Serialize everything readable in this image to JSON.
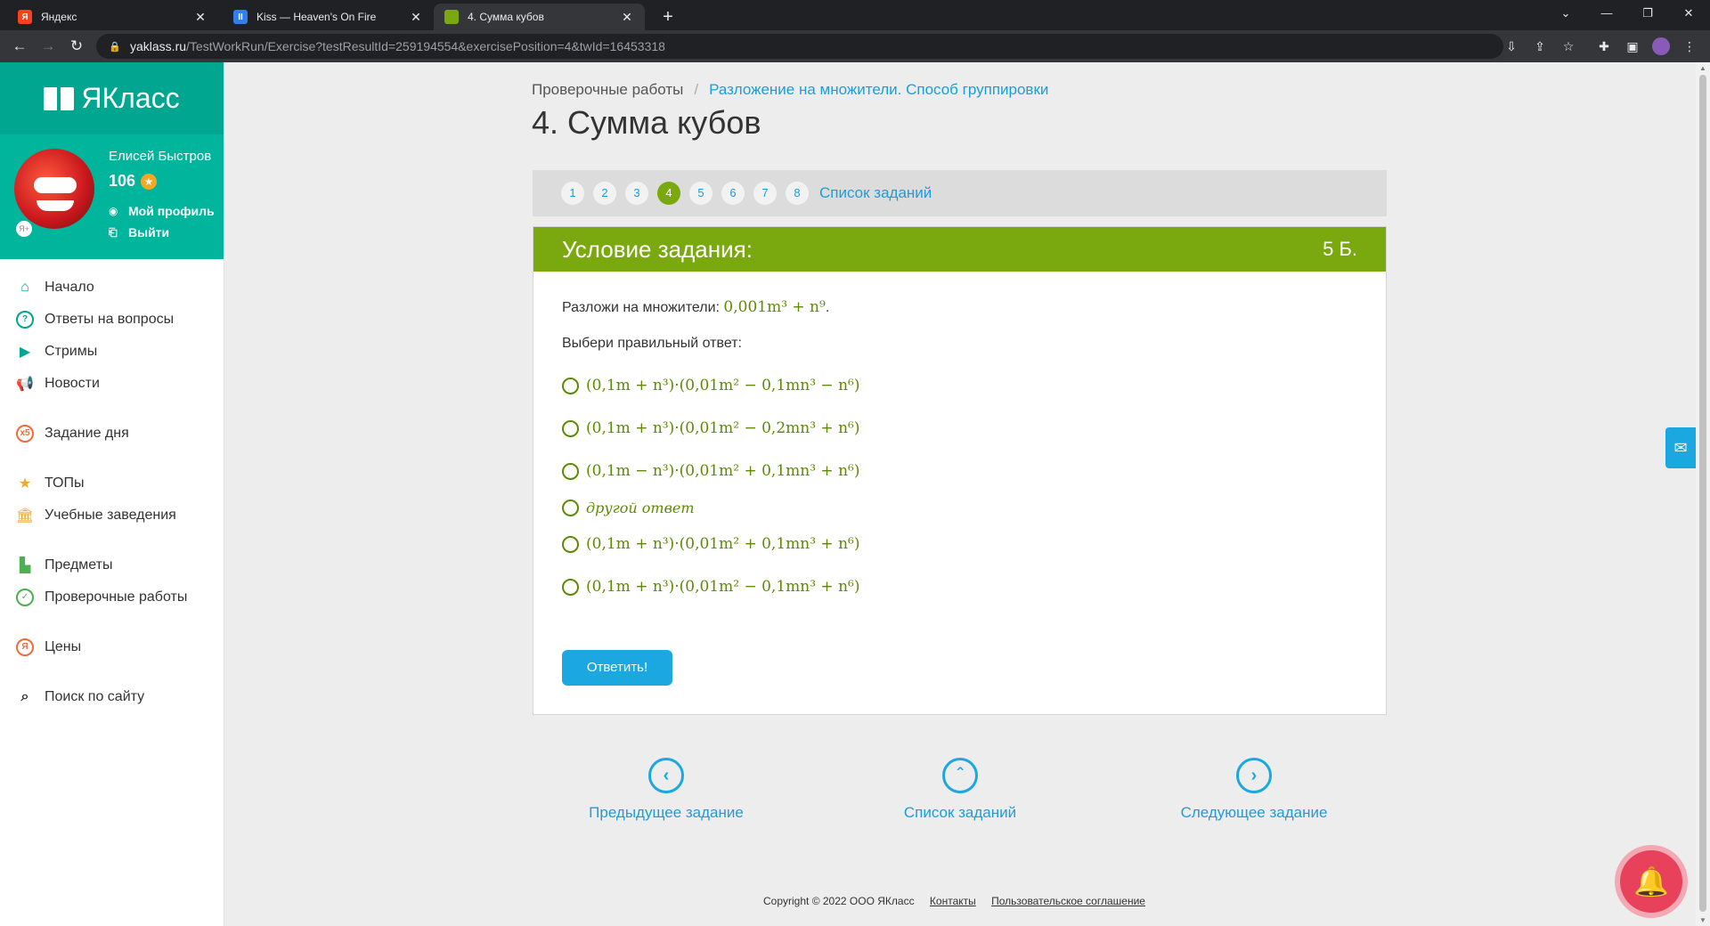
{
  "browser": {
    "tabs": [
      {
        "title": "Яндекс",
        "favicon": "Я",
        "color": "#fc3f1d"
      },
      {
        "title": "Kiss — Heaven's On Fire",
        "favicon": "II",
        "color": "#2f80ed"
      },
      {
        "title": "4. Сумма кубов",
        "favicon": "",
        "color": "#7aa80f"
      }
    ],
    "url_host": "yaklass.ru",
    "url_path": "/TestWorkRun/Exercise?testResultId=259194554&exercisePosition=4&twId=16453318"
  },
  "sidebar": {
    "logo_text": "ЯКласс",
    "user": {
      "name": "Елисей Быстров",
      "points": "106",
      "profile_link": "Мой профиль",
      "logout_link": "Выйти"
    },
    "menu": [
      {
        "label": "Начало",
        "icon": "home-icon"
      },
      {
        "label": "Ответы на вопросы",
        "icon": "question-icon"
      },
      {
        "label": "Стримы",
        "icon": "play-icon"
      },
      {
        "label": "Новости",
        "icon": "megaphone-icon"
      },
      {
        "label": "Задание дня",
        "icon": "x5-icon"
      },
      {
        "label": "ТОПы",
        "icon": "star-icon"
      },
      {
        "label": "Учебные заведения",
        "icon": "building-icon"
      },
      {
        "label": "Предметы",
        "icon": "books-icon"
      },
      {
        "label": "Проверочные работы",
        "icon": "check-icon"
      },
      {
        "label": "Цены",
        "icon": "coin-icon"
      },
      {
        "label": "Поиск по сайту",
        "icon": "search-icon"
      }
    ]
  },
  "main": {
    "breadcrumb_root": "Проверочные работы",
    "breadcrumb_current": "Разложение на множители. Способ группировки",
    "title": "4. Сумма кубов",
    "pages": [
      "1",
      "2",
      "3",
      "4",
      "5",
      "6",
      "7",
      "8"
    ],
    "current_page": "4",
    "task_list_link": "Список заданий",
    "task_header": "Условие задания:",
    "score": "5 Б.",
    "question_prefix": "Разложи на множители:",
    "question_math": "0,001m³ + n⁹",
    "choose_prompt": "Выбери правильный ответ:",
    "options": [
      "(0,1m + n³)·(0,01m² − 0,1mn³ − n⁶)",
      "(0,1m + n³)·(0,01m² − 0,2mn³ + n⁶)",
      "(0,1m − n³)·(0,01m² + 0,1mn³ + n⁶)",
      "другой ответ",
      "(0,1m + n³)·(0,01m² + 0,1mn³ + n⁶)",
      "(0,1m + n³)·(0,01m² − 0,1mn³ + n⁶)"
    ],
    "answer_button": "Ответить!",
    "nav_prev": "Предыдущее задание",
    "nav_list": "Список заданий",
    "nav_next": "Следующее задание"
  },
  "footer": {
    "copyright": "Copyright © 2022 ООО ЯКласс",
    "contacts": "Контакты",
    "agreement": "Пользовательское соглашение"
  },
  "colors": {
    "accent_green": "#7aa80f",
    "teal": "#00a68f",
    "link_blue": "#1a9ed9"
  }
}
